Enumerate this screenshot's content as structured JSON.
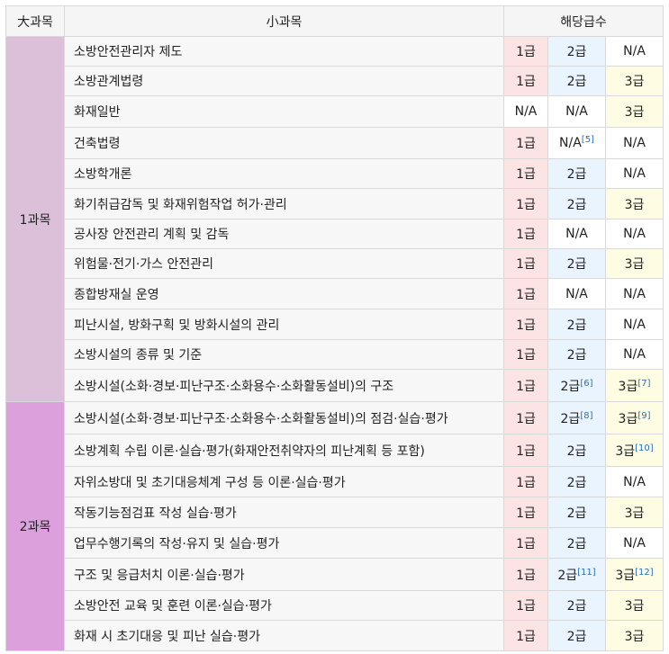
{
  "headers": {
    "major": "大과목",
    "minor": "小과목",
    "grade": "해당급수"
  },
  "groups": [
    {
      "label": "1과목",
      "color": "#dcc0da",
      "rows": [
        {
          "name": "소방안전관리자 제도",
          "g": [
            [
              "1급",
              "g1",
              ""
            ],
            [
              "2급",
              "g2",
              ""
            ],
            [
              "N/A",
              "gna",
              ""
            ]
          ]
        },
        {
          "name": "소방관계법령",
          "g": [
            [
              "1급",
              "g1",
              ""
            ],
            [
              "2급",
              "g2",
              ""
            ],
            [
              "3급",
              "g3",
              ""
            ]
          ]
        },
        {
          "name": "화재일반",
          "g": [
            [
              "N/A",
              "gna",
              ""
            ],
            [
              "N/A",
              "gna",
              ""
            ],
            [
              "3급",
              "g3",
              ""
            ]
          ]
        },
        {
          "name": "건축법령",
          "g": [
            [
              "1급",
              "g1",
              ""
            ],
            [
              "N/A",
              "gna",
              "[5]"
            ],
            [
              "N/A",
              "gna",
              ""
            ]
          ]
        },
        {
          "name": "소방학개론",
          "g": [
            [
              "1급",
              "g1",
              ""
            ],
            [
              "2급",
              "g2",
              ""
            ],
            [
              "N/A",
              "gna",
              ""
            ]
          ]
        },
        {
          "name": "화기취급감독 및 화재위험작업 허가·관리",
          "g": [
            [
              "1급",
              "g1",
              ""
            ],
            [
              "2급",
              "g2",
              ""
            ],
            [
              "3급",
              "g3",
              ""
            ]
          ]
        },
        {
          "name": "공사장 안전관리 계획 및 감독",
          "g": [
            [
              "1급",
              "g1",
              ""
            ],
            [
              "N/A",
              "gna",
              ""
            ],
            [
              "N/A",
              "gna",
              ""
            ]
          ]
        },
        {
          "name": "위험물·전기·가스 안전관리",
          "g": [
            [
              "1급",
              "g1",
              ""
            ],
            [
              "2급",
              "g2",
              ""
            ],
            [
              "3급",
              "g3",
              ""
            ]
          ]
        },
        {
          "name": "종합방재실 운영",
          "g": [
            [
              "1급",
              "g1",
              ""
            ],
            [
              "N/A",
              "gna",
              ""
            ],
            [
              "N/A",
              "gna",
              ""
            ]
          ]
        },
        {
          "name": "피난시설, 방화구획 및 방화시설의 관리",
          "g": [
            [
              "1급",
              "g1",
              ""
            ],
            [
              "2급",
              "g2",
              ""
            ],
            [
              "N/A",
              "gna",
              ""
            ]
          ]
        },
        {
          "name": "소방시설의 종류 및 기준",
          "g": [
            [
              "1급",
              "g1",
              ""
            ],
            [
              "2급",
              "g2",
              ""
            ],
            [
              "N/A",
              "gna",
              ""
            ]
          ]
        },
        {
          "name": "소방시설(소화·경보·피난구조·소화용수·소화활동설비)의 구조",
          "g": [
            [
              "1급",
              "g1",
              ""
            ],
            [
              "2급",
              "g2",
              "[6]"
            ],
            [
              "3급",
              "g3",
              "[7]"
            ]
          ]
        }
      ]
    },
    {
      "label": "2과목",
      "color": "#dca0dc",
      "rows": [
        {
          "name": "소방시설(소화·경보·피난구조·소화용수·소화활동설비)의 점검·실습·평가",
          "g": [
            [
              "1급",
              "g1",
              ""
            ],
            [
              "2급",
              "g2",
              "[8]"
            ],
            [
              "3급",
              "g3",
              "[9]"
            ]
          ]
        },
        {
          "name": "소방계획 수립 이론·실습·평가(화재안전취약자의 피난계획 등 포함)",
          "g": [
            [
              "1급",
              "g1",
              ""
            ],
            [
              "2급",
              "g2",
              ""
            ],
            [
              "3급",
              "g3",
              "[10]"
            ]
          ]
        },
        {
          "name": "자위소방대 및 초기대응체계 구성 등 이론·실습·평가",
          "g": [
            [
              "1급",
              "g1",
              ""
            ],
            [
              "2급",
              "g2",
              ""
            ],
            [
              "N/A",
              "gna",
              ""
            ]
          ]
        },
        {
          "name": "작동기능점검표 작성 실습·평가",
          "g": [
            [
              "1급",
              "g1",
              ""
            ],
            [
              "2급",
              "g2",
              ""
            ],
            [
              "3급",
              "g3",
              ""
            ]
          ]
        },
        {
          "name": "업무수행기록의 작성·유지 및 실습·평가",
          "g": [
            [
              "1급",
              "g1",
              ""
            ],
            [
              "2급",
              "g2",
              ""
            ],
            [
              "N/A",
              "gna",
              ""
            ]
          ]
        },
        {
          "name": "구조 및 응급처치 이론·실습·평가",
          "g": [
            [
              "1급",
              "g1",
              ""
            ],
            [
              "2급",
              "g2",
              "[11]"
            ],
            [
              "3급",
              "g3",
              "[12]"
            ]
          ]
        },
        {
          "name": "소방안전 교육 및 훈련 이론·실습·평가",
          "g": [
            [
              "1급",
              "g1",
              ""
            ],
            [
              "2급",
              "g2",
              ""
            ],
            [
              "3급",
              "g3",
              ""
            ]
          ]
        },
        {
          "name": "화재 시 초기대응 및 피난 실습·평가",
          "g": [
            [
              "1급",
              "g1",
              ""
            ],
            [
              "2급",
              "g2",
              ""
            ],
            [
              "3급",
              "g3",
              ""
            ]
          ]
        }
      ]
    }
  ]
}
